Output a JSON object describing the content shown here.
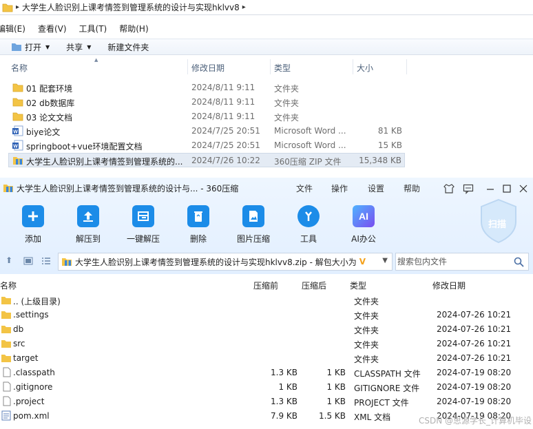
{
  "explorer": {
    "breadcrumb": "大学生人脸识别上课考情签到管理系统的设计与实现hklvv8",
    "menu": [
      "编辑(E)",
      "查看(V)",
      "工具(T)",
      "帮助(H)"
    ],
    "toolbar": {
      "open": "打开",
      "share": "共享",
      "new_folder": "新建文件夹"
    },
    "columns": {
      "name": "名称",
      "modified": "修改日期",
      "type": "类型",
      "size": "大小"
    },
    "rows": [
      {
        "name": "01 配套环境",
        "date": "2024/8/11 9:11",
        "type": "文件夹",
        "size": ""
      },
      {
        "name": "02 db数据库",
        "date": "2024/8/11 9:11",
        "type": "文件夹",
        "size": ""
      },
      {
        "name": "03 论文文档",
        "date": "2024/8/11 9:11",
        "type": "文件夹",
        "size": ""
      },
      {
        "name": "biye论文",
        "date": "2024/7/25 20:51",
        "type": "Microsoft Word ...",
        "size": "81 KB"
      },
      {
        "name": "springboot+vue环境配置文档",
        "date": "2024/7/25 20:51",
        "type": "Microsoft Word ...",
        "size": "15 KB"
      },
      {
        "name": "大学生人脸识别上课考情签到管理系统的...",
        "date": "2024/7/26 10:22",
        "type": "360压缩 ZIP 文件",
        "size": "15,348 KB"
      }
    ]
  },
  "zip": {
    "title": "大学生人脸识别上课考情签到管理系统的设计与... - 360压缩",
    "menu": [
      "文件",
      "操作",
      "设置",
      "帮助"
    ],
    "tools": [
      "添加",
      "解压到",
      "一键解压",
      "删除",
      "图片压缩",
      "工具",
      "AI办公"
    ],
    "scan_label": "扫描",
    "path": "大学生人脸识别上课考情签到管理系统的设计与实现hklvv8.zip - 解包大小为",
    "search_placeholder": "搜索包内文件",
    "columns": {
      "name": "名称",
      "before": "压缩前",
      "after": "压缩后",
      "type": "类型",
      "modified": "修改日期"
    },
    "rows": [
      {
        "name": ".. (上级目录)",
        "before": "",
        "after": "",
        "type": "文件夹",
        "date": ""
      },
      {
        "name": ".settings",
        "before": "",
        "after": "",
        "type": "文件夹",
        "date": "2024-07-26 10:21"
      },
      {
        "name": "db",
        "before": "",
        "after": "",
        "type": "文件夹",
        "date": "2024-07-26 10:21"
      },
      {
        "name": "src",
        "before": "",
        "after": "",
        "type": "文件夹",
        "date": "2024-07-26 10:21"
      },
      {
        "name": "target",
        "before": "",
        "after": "",
        "type": "文件夹",
        "date": "2024-07-26 10:21"
      },
      {
        "name": ".classpath",
        "before": "1.3 KB",
        "after": "1 KB",
        "type": "CLASSPATH 文件",
        "date": "2024-07-19 08:20"
      },
      {
        "name": ".gitignore",
        "before": "1 KB",
        "after": "1 KB",
        "type": "GITIGNORE 文件",
        "date": "2024-07-19 08:20"
      },
      {
        "name": ".project",
        "before": "1.3 KB",
        "after": "1 KB",
        "type": "PROJECT 文件",
        "date": "2024-07-19 08:20"
      },
      {
        "name": "pom.xml",
        "before": "7.9 KB",
        "after": "1.5 KB",
        "type": "XML 文档",
        "date": "2024-07-19 08:20"
      }
    ]
  },
  "watermark": "CSDN @思源学长_计算机毕设",
  "colors": {
    "folder": "#f3c445",
    "accent": "#1c8ce8",
    "word": "#2b5fb5",
    "ai": "#7a4df0"
  }
}
